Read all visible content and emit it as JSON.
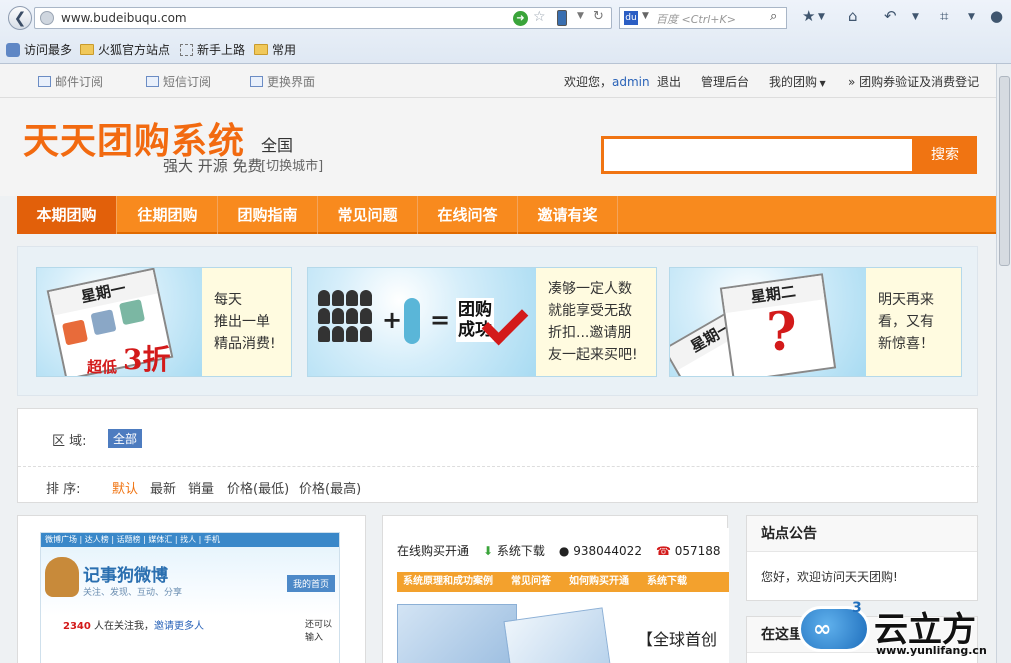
{
  "browser": {
    "url": "www.budeibuqu.com",
    "search_placeholder": "百度 <Ctrl+K>",
    "bookmarks": [
      "访问最多",
      "火狐官方站点",
      "新手上路",
      "常用"
    ]
  },
  "topbar": {
    "left_links": [
      "邮件订阅",
      "短信订阅",
      "更换界面"
    ],
    "welcome": "欢迎您，",
    "user": "admin",
    "logout": "退出",
    "admin_panel": "管理后台",
    "my_groupbuy": "我的团购",
    "verify": "» 团购券验证及消费登记"
  },
  "header": {
    "logo": "天天团购系统",
    "city": "全国",
    "slogan": "强大 开源 免费",
    "switch_city": "[切换城市]",
    "search_button": "搜索"
  },
  "nav": {
    "items": [
      "本期团购",
      "往期团购",
      "团购指南",
      "常见问题",
      "在线问答",
      "邀请有奖"
    ],
    "active_index": 0
  },
  "banner": {
    "card1": {
      "calendar": "星期一",
      "badge_prefix": "超低",
      "badge_value": "3折",
      "text": [
        "每天",
        "推出一单",
        "精品消费!"
      ]
    },
    "card2": {
      "result": [
        "团购",
        "成功"
      ],
      "text": [
        "凑够一定人数",
        "就能享受无敌",
        "折扣...邀请朋",
        "友一起来买吧!"
      ]
    },
    "card3": {
      "calendar_front": "星期二",
      "calendar_back": "星期一",
      "text": [
        "明天再来",
        "看，又有",
        "新惊喜！"
      ]
    }
  },
  "filter": {
    "area_label": "区  域:",
    "area_value": "全部",
    "sort_label": "排  序:",
    "sort_options": [
      "默认",
      "最新",
      "销量",
      "价格(最低)",
      "价格(最高)"
    ],
    "sort_active_index": 0
  },
  "deals": {
    "weibo": {
      "top": "微博广场 | 达人榜 | 话题榜 | 媒体汇 | 找人 | 手机",
      "title": "记事狗微博",
      "subtitle": "关注、发现、互动、分享",
      "home_button": "我的首页",
      "count": "2340",
      "count_text": " 人在关注我，",
      "invite": "邀请更多人",
      "can_input": "还可以输入"
    },
    "ad": {
      "row": [
        "在线购买开通",
        "系统下载",
        "938044022",
        "057188"
      ],
      "bar": [
        "系统原理和成功案例",
        "常见问答",
        "如何购买开通",
        "系统下载"
      ],
      "global": "【全球首创"
    }
  },
  "sidebar": {
    "notice_title": "站点公告",
    "notice_body": "您好，欢迎访问天天团购!",
    "box2_title": "在这里关注我们"
  },
  "watermark": {
    "brand": "云立方",
    "url": "www.yunlifang.cn",
    "number": "3"
  }
}
